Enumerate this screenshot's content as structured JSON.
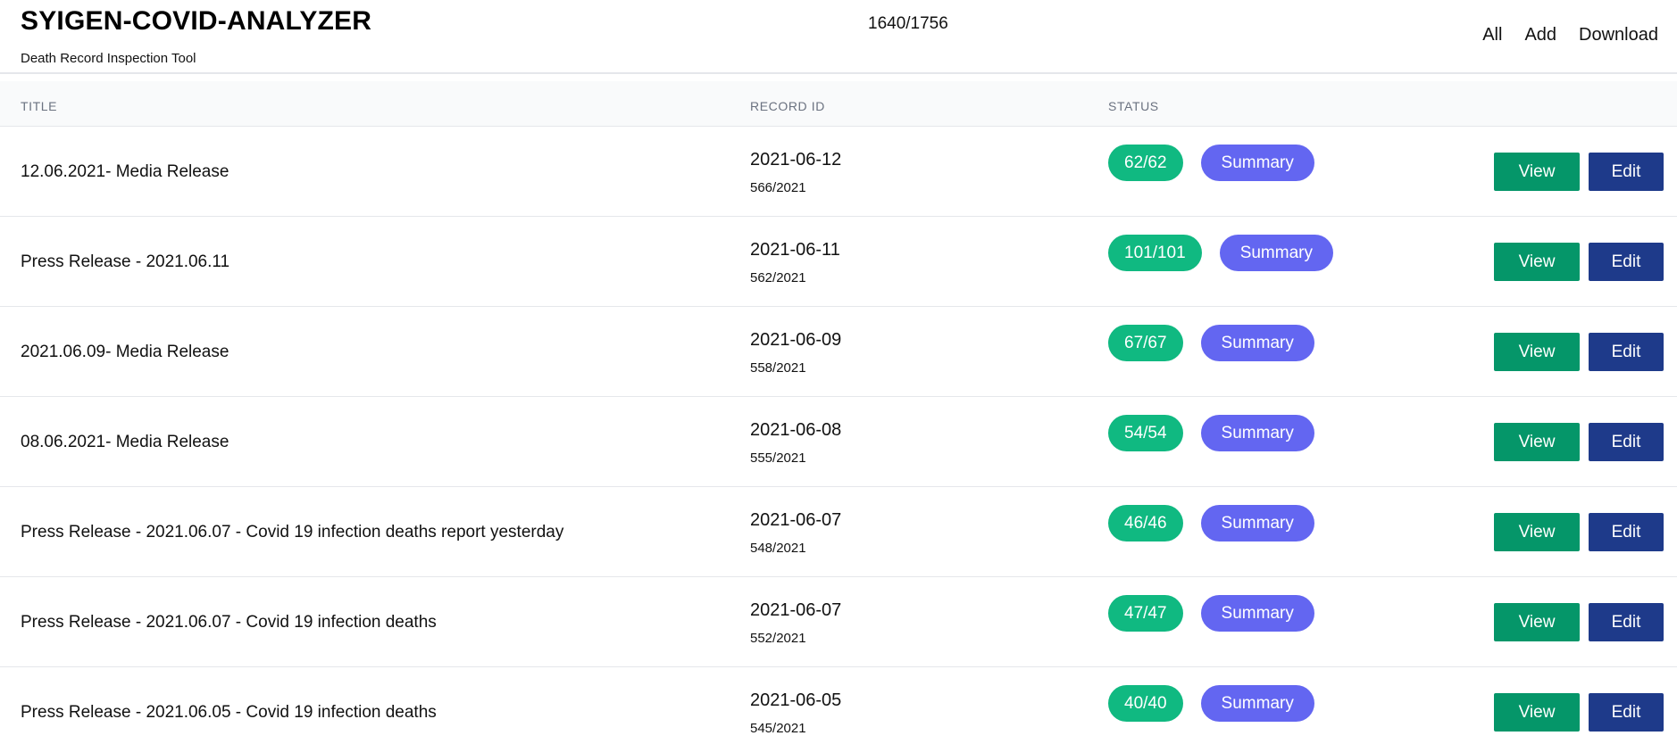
{
  "header": {
    "title": "SYIGEN-COVID-ANALYZER",
    "subtitle": "Death Record Inspection Tool",
    "counter": "1640/1756",
    "nav": {
      "all": "All",
      "add": "Add",
      "download": "Download"
    }
  },
  "table": {
    "columns": {
      "title": "TITLE",
      "record_id": "RECORD ID",
      "status": "STATUS"
    },
    "summary_label": "Summary",
    "view_label": "View",
    "edit_label": "Edit",
    "rows": [
      {
        "title": "12.06.2021- Media Release",
        "date": "2021-06-12",
        "record": "566/2021",
        "count": "62/62"
      },
      {
        "title": "Press Release - 2021.06.11",
        "date": "2021-06-11",
        "record": "562/2021",
        "count": "101/101"
      },
      {
        "title": "2021.06.09- Media Release",
        "date": "2021-06-09",
        "record": "558/2021",
        "count": "67/67"
      },
      {
        "title": "08.06.2021- Media Release",
        "date": "2021-06-08",
        "record": "555/2021",
        "count": "54/54"
      },
      {
        "title": "Press Release - 2021.06.07 - Covid 19 infection deaths report yesterday",
        "date": "2021-06-07",
        "record": "548/2021",
        "count": "46/46"
      },
      {
        "title": "Press Release - 2021.06.07 - Covid 19 infection deaths",
        "date": "2021-06-07",
        "record": "552/2021",
        "count": "47/47"
      },
      {
        "title": "Press Release - 2021.06.05 - Covid 19 infection deaths",
        "date": "2021-06-05",
        "record": "545/2021",
        "count": "40/40"
      }
    ]
  },
  "colors": {
    "count_pill": "#10b981",
    "summary_pill": "#6366f1",
    "view_button": "#059669",
    "edit_button": "#1e3a8a"
  }
}
